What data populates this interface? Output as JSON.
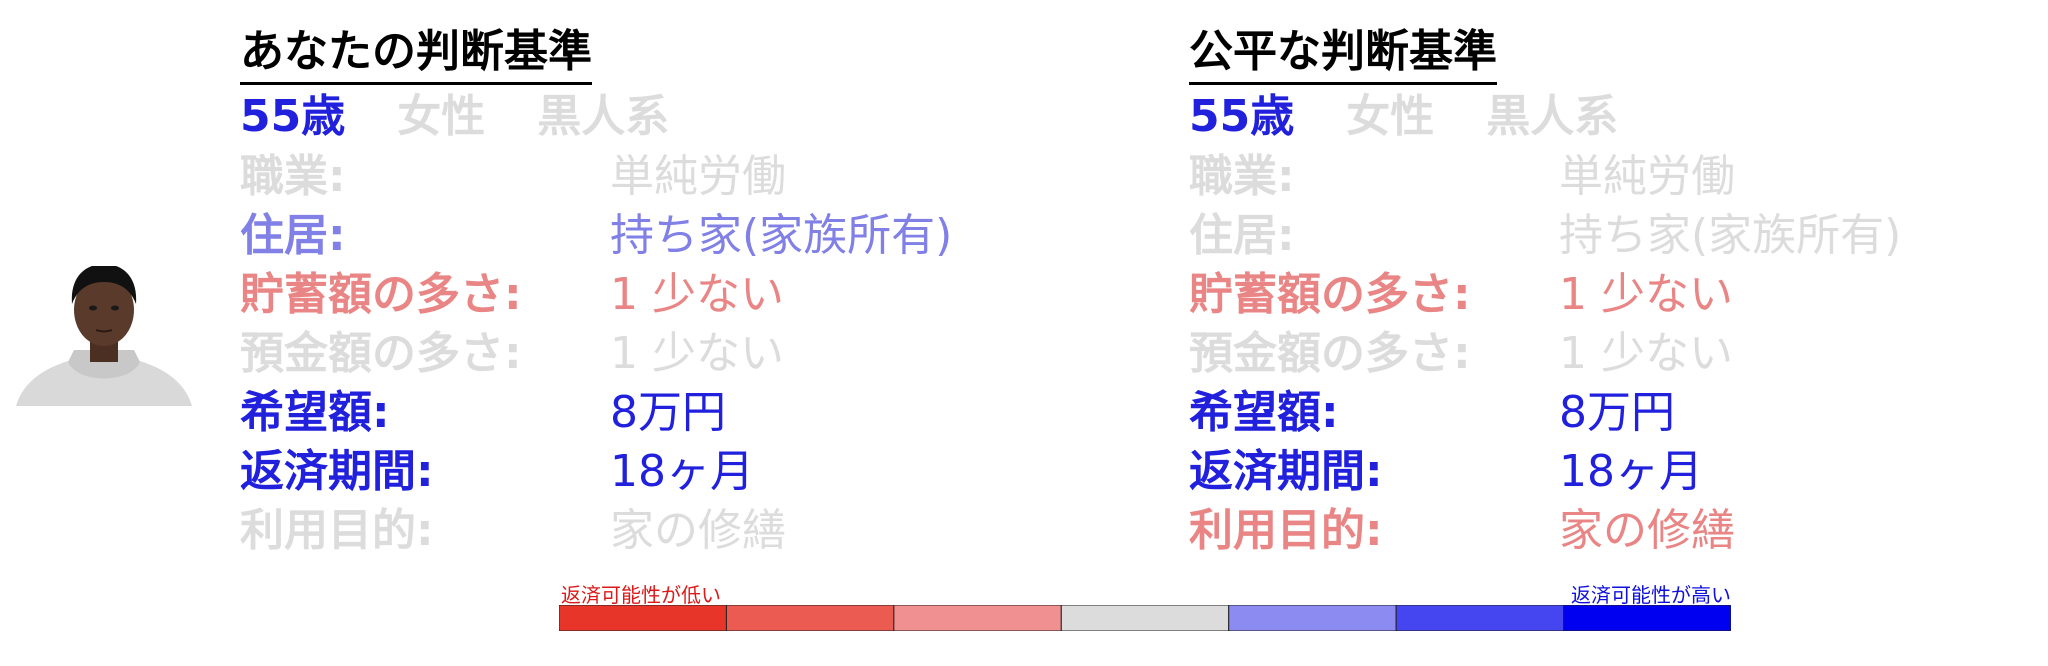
{
  "colors": {
    "blue": "#2020dd",
    "light_blue": "#8080e6",
    "light_red": "#e98585",
    "grey": "#dcdcdc",
    "low_label": "#dd1a1a",
    "high_label": "#1010dd"
  },
  "panels": [
    {
      "title": "あなたの判断基準",
      "demographics": [
        {
          "text": "55歳",
          "tone": "blue"
        },
        {
          "text": "女性",
          "tone": "grey"
        },
        {
          "text": "黒人系",
          "tone": "grey"
        }
      ],
      "rows": [
        {
          "label": "職業:",
          "value": "単純労働",
          "tone": "grey"
        },
        {
          "label": "住居:",
          "value": "持ち家(家族所有)",
          "tone": "lblue"
        },
        {
          "label": "貯蓄額の多さ:",
          "value": "1 少ない",
          "tone": "lred"
        },
        {
          "label": "預金額の多さ:",
          "value": "1 少ない",
          "tone": "grey"
        },
        {
          "label": "希望額:",
          "value": "8万円",
          "tone": "blue"
        },
        {
          "label": "返済期間:",
          "value": "18ヶ月",
          "tone": "blue"
        },
        {
          "label": "利用目的:",
          "value": "家の修繕",
          "tone": "grey"
        }
      ]
    },
    {
      "title": "公平な判断基準",
      "demographics": [
        {
          "text": "55歳",
          "tone": "blue"
        },
        {
          "text": "女性",
          "tone": "grey"
        },
        {
          "text": "黒人系",
          "tone": "grey"
        }
      ],
      "rows": [
        {
          "label": "職業:",
          "value": "単純労働",
          "tone": "grey"
        },
        {
          "label": "住居:",
          "value": "持ち家(家族所有)",
          "tone": "grey"
        },
        {
          "label": "貯蓄額の多さ:",
          "value": "1 少ない",
          "tone": "lred"
        },
        {
          "label": "預金額の多さ:",
          "value": "1 少ない",
          "tone": "grey"
        },
        {
          "label": "希望額:",
          "value": "8万円",
          "tone": "blue"
        },
        {
          "label": "返済期間:",
          "value": "18ヶ月",
          "tone": "blue"
        },
        {
          "label": "利用目的:",
          "value": "家の修繕",
          "tone": "lred"
        }
      ]
    }
  ],
  "scale": {
    "low_label": "返済可能性が低い",
    "high_label": "返済可能性が高い",
    "colors": [
      "#e8352a",
      "#ec5b52",
      "#f09090",
      "#dcdcdc",
      "#8b8bf2",
      "#4646f0",
      "#0000f0"
    ]
  }
}
